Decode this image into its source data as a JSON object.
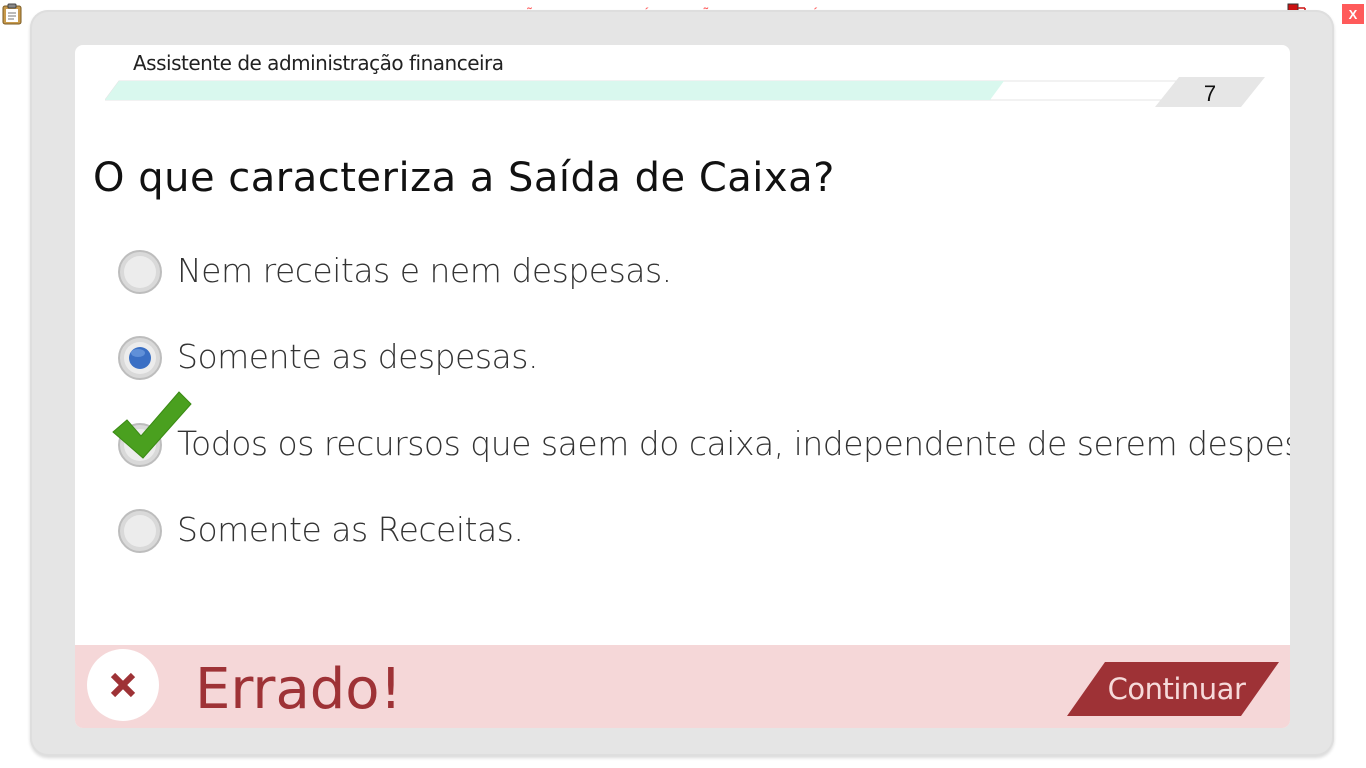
{
  "window": {
    "banner": "VERSÃO PARA FUNCIONÁRIOS - NÃO COMERCIALIZÁVEL",
    "close_label": "X"
  },
  "header": {
    "course_title": "Assistente de administração financeira",
    "page_number": "7",
    "progress": 0.83
  },
  "question": {
    "text": "O que caracteriza a Saída de Caixa?",
    "options": [
      {
        "label": "Nem receitas e nem despesas.",
        "selected": false,
        "correct": false
      },
      {
        "label": "Somente as despesas.",
        "selected": true,
        "correct": false
      },
      {
        "label": "Todos os recursos que saem do caixa, independente de serem despesas.",
        "selected": false,
        "correct": true
      },
      {
        "label": "Somente as Receitas.",
        "selected": false,
        "correct": false
      }
    ]
  },
  "feedback": {
    "result": "Errado!",
    "continue_label": "Continuar"
  },
  "colors": {
    "error_text": "#9e3236",
    "error_bg": "#f5d7d8",
    "progress_fill": "#d9f8ee",
    "check": "#4aa01f",
    "radio_selected": "#3a6fc4"
  }
}
